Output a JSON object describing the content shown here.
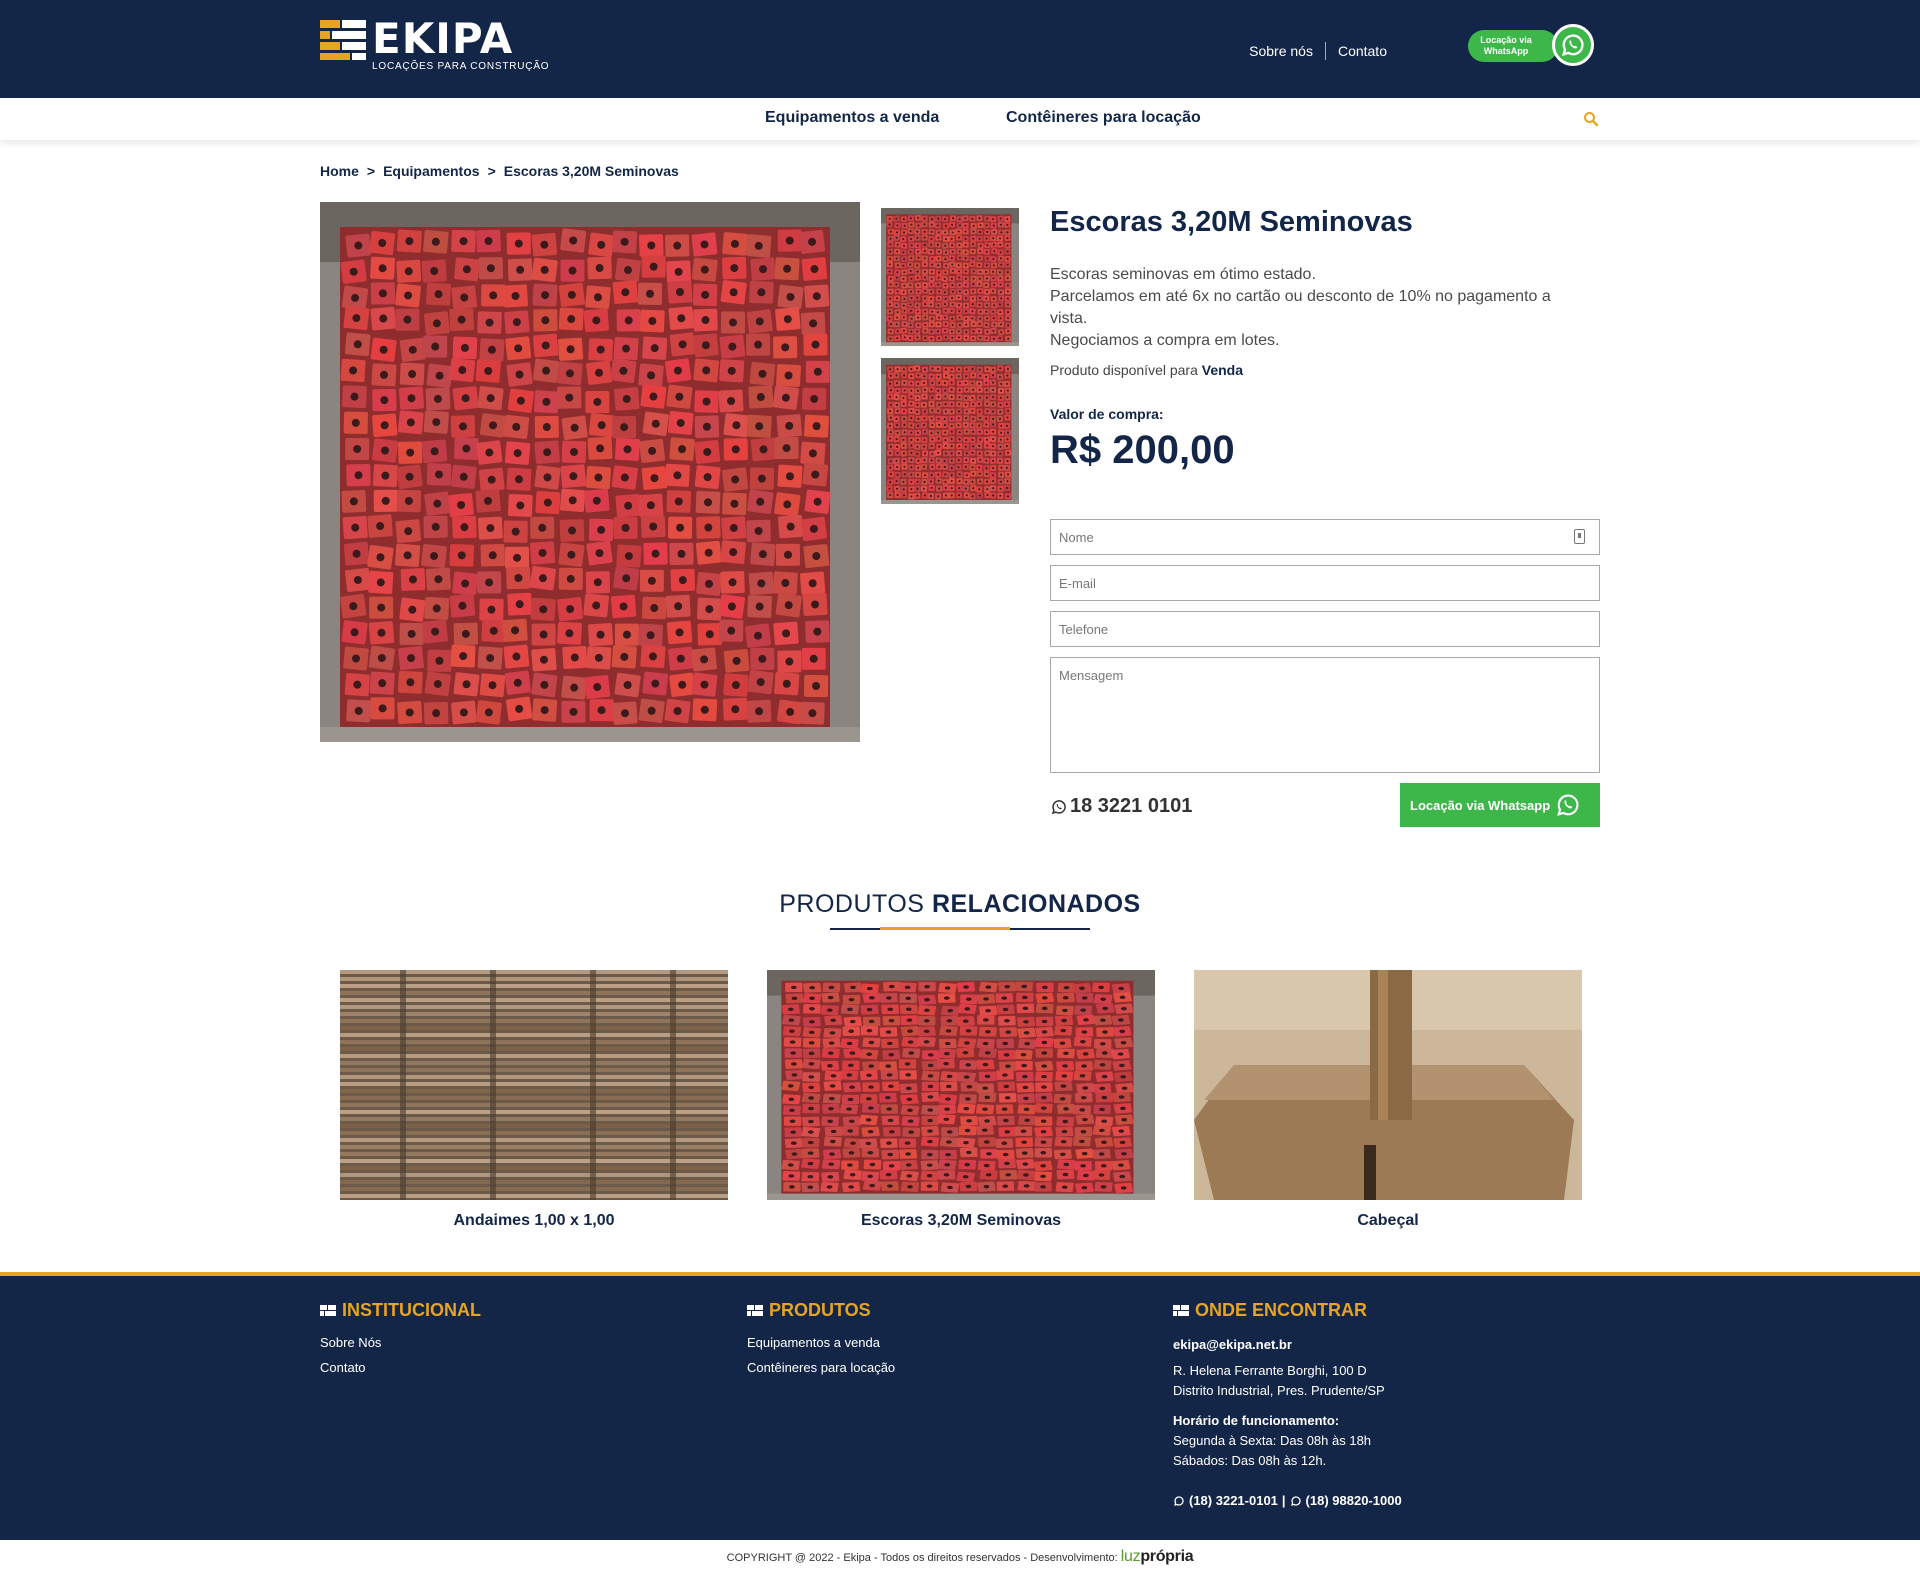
{
  "header": {
    "logo_text": "EKIPA",
    "logo_subtitle": "LOCAÇÕES PARA CONSTRUÇÃO",
    "links": [
      "Sobre nós",
      "Contato"
    ],
    "whatsapp_badge": "Locação via WhatsApp"
  },
  "nav": {
    "items": [
      "Equipamentos a venda",
      "Contêineres para locação"
    ]
  },
  "breadcrumb": {
    "items": [
      "Home",
      "Equipamentos",
      "Escoras 3,20M Seminovas"
    ],
    "separator": ">"
  },
  "product": {
    "title": "Escoras 3,20M Seminovas",
    "description": [
      "Escoras seminovas em ótimo estado.",
      "Parcelamos em até 6x no cartão ou desconto de 10% no pagamento a vista.",
      "Negociamos a compra em lotes."
    ],
    "availability_prefix": "Produto disponível para",
    "availability_value": "Venda",
    "price_label": "Valor de compra:",
    "price": "R$ 200,00"
  },
  "form": {
    "name_placeholder": "Nome",
    "email_placeholder": "E-mail",
    "phone_placeholder": "Telefone",
    "message_placeholder": "Mensagem",
    "phone_number": "18 3221 0101",
    "whatsapp_button": "Locação via Whatsapp"
  },
  "related": {
    "title_light": "PRODUTOS",
    "title_bold": "RELACIONADOS",
    "items": [
      {
        "name": "Andaimes 1,00 x 1,00"
      },
      {
        "name": "Escoras 3,20M Seminovas"
      },
      {
        "name": "Cabeçal"
      }
    ]
  },
  "footer": {
    "institucional": {
      "title": "INSTITUCIONAL",
      "links": [
        "Sobre Nós",
        "Contato"
      ]
    },
    "produtos": {
      "title": "PRODUTOS",
      "links": [
        "Equipamentos a venda",
        "Contêineres para locação"
      ]
    },
    "onde": {
      "title": "ONDE ENCONTRAR",
      "email": "ekipa@ekipa.net.br",
      "address_line1": "R. Helena Ferrante Borghi, 100 D",
      "address_line2": "Distrito Industrial, Pres. Prudente/SP",
      "hours_label": "Horário de funcionamento:",
      "hours_weekdays": "Segunda à Sexta: Das 08h às 18h",
      "hours_saturday": "Sábados: Das 08h às 12h.",
      "phone1": "(18) 3221-0101",
      "phone_sep": "|",
      "phone2": "(18) 98820-1000"
    },
    "copyright": "COPYRIGHT @ 2022 - Ekipa - Todos os direitos reservados - Desenvolvimento:",
    "dev_brand_a": "luz",
    "dev_brand_b": "própria"
  },
  "colors": {
    "navy": "#132647",
    "gold": "#e7a423",
    "whatsapp_green": "#3db74a",
    "product_red": "#c8484a"
  }
}
